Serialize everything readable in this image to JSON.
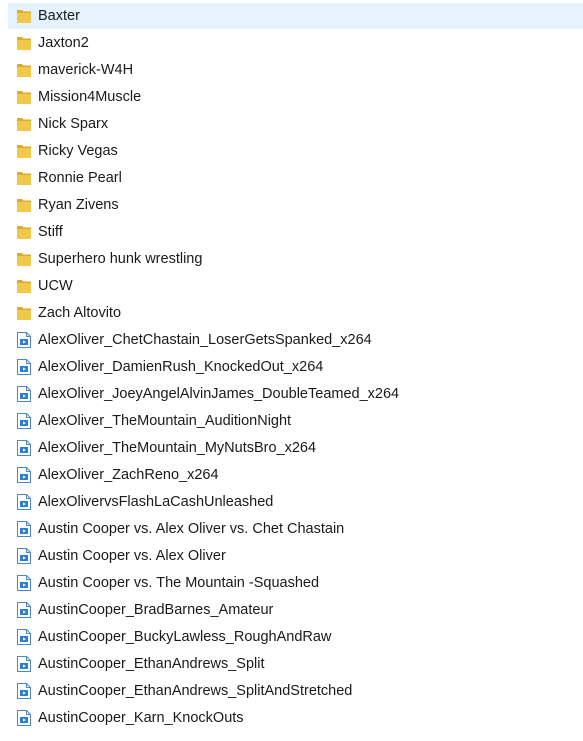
{
  "colors": {
    "folder": "#f2c84b",
    "folder_shade": "#dcaa2c",
    "selection": "#e5f3ff",
    "video_border": "#4a86c8",
    "video_fill": "#2f7ec8"
  },
  "items": [
    {
      "name": "Baxter",
      "type": "folder",
      "selected": true
    },
    {
      "name": "Jaxton2",
      "type": "folder"
    },
    {
      "name": "maverick-W4H",
      "type": "folder"
    },
    {
      "name": "Mission4Muscle",
      "type": "folder"
    },
    {
      "name": "Nick Sparx",
      "type": "folder"
    },
    {
      "name": "Ricky Vegas",
      "type": "folder"
    },
    {
      "name": "Ronnie Pearl",
      "type": "folder"
    },
    {
      "name": "Ryan Zivens",
      "type": "folder"
    },
    {
      "name": "Stiff",
      "type": "folder"
    },
    {
      "name": "Superhero hunk wrestling",
      "type": "folder"
    },
    {
      "name": "UCW",
      "type": "folder"
    },
    {
      "name": "Zach Altovito",
      "type": "folder"
    },
    {
      "name": "AlexOliver_ChetChastain_LoserGetsSpanked_x264",
      "type": "video"
    },
    {
      "name": "AlexOliver_DamienRush_KnockedOut_x264",
      "type": "video"
    },
    {
      "name": "AlexOliver_JoeyAngelAlvinJames_DoubleTeamed_x264",
      "type": "video"
    },
    {
      "name": "AlexOliver_TheMountain_AuditionNight",
      "type": "video"
    },
    {
      "name": "AlexOliver_TheMountain_MyNutsBro_x264",
      "type": "video"
    },
    {
      "name": "AlexOliver_ZachReno_x264",
      "type": "video"
    },
    {
      "name": "AlexOlivervsFlashLaCashUnleashed",
      "type": "video"
    },
    {
      "name": "Austin Cooper vs. Alex Oliver vs. Chet Chastain",
      "type": "video"
    },
    {
      "name": "Austin Cooper vs. Alex Oliver",
      "type": "video"
    },
    {
      "name": "Austin Cooper vs. The Mountain -Squashed",
      "type": "video"
    },
    {
      "name": "AustinCooper_BradBarnes_Amateur",
      "type": "video"
    },
    {
      "name": "AustinCooper_BuckyLawless_RoughAndRaw",
      "type": "video"
    },
    {
      "name": "AustinCooper_EthanAndrews_Split",
      "type": "video"
    },
    {
      "name": "AustinCooper_EthanAndrews_SplitAndStretched",
      "type": "video"
    },
    {
      "name": "AustinCooper_Karn_KnockOuts",
      "type": "video"
    }
  ]
}
